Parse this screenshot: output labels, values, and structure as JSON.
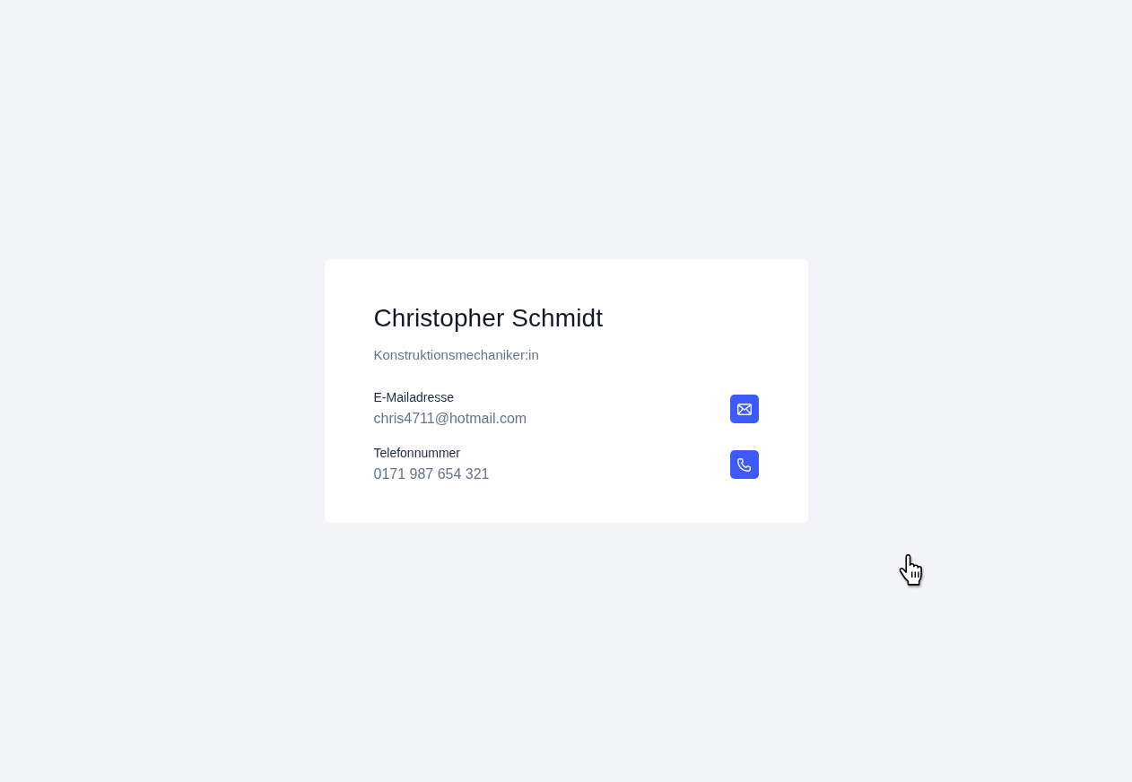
{
  "card": {
    "name": "Christopher Schmidt",
    "title": "Konstruktionsmechaniker:in",
    "contacts": [
      {
        "kind": "email",
        "label": "E-Mailadresse",
        "value": "chris4711@hotmail.com"
      },
      {
        "kind": "phone",
        "label": "Telefonnummer",
        "value": "0171 987 654 321"
      }
    ]
  }
}
